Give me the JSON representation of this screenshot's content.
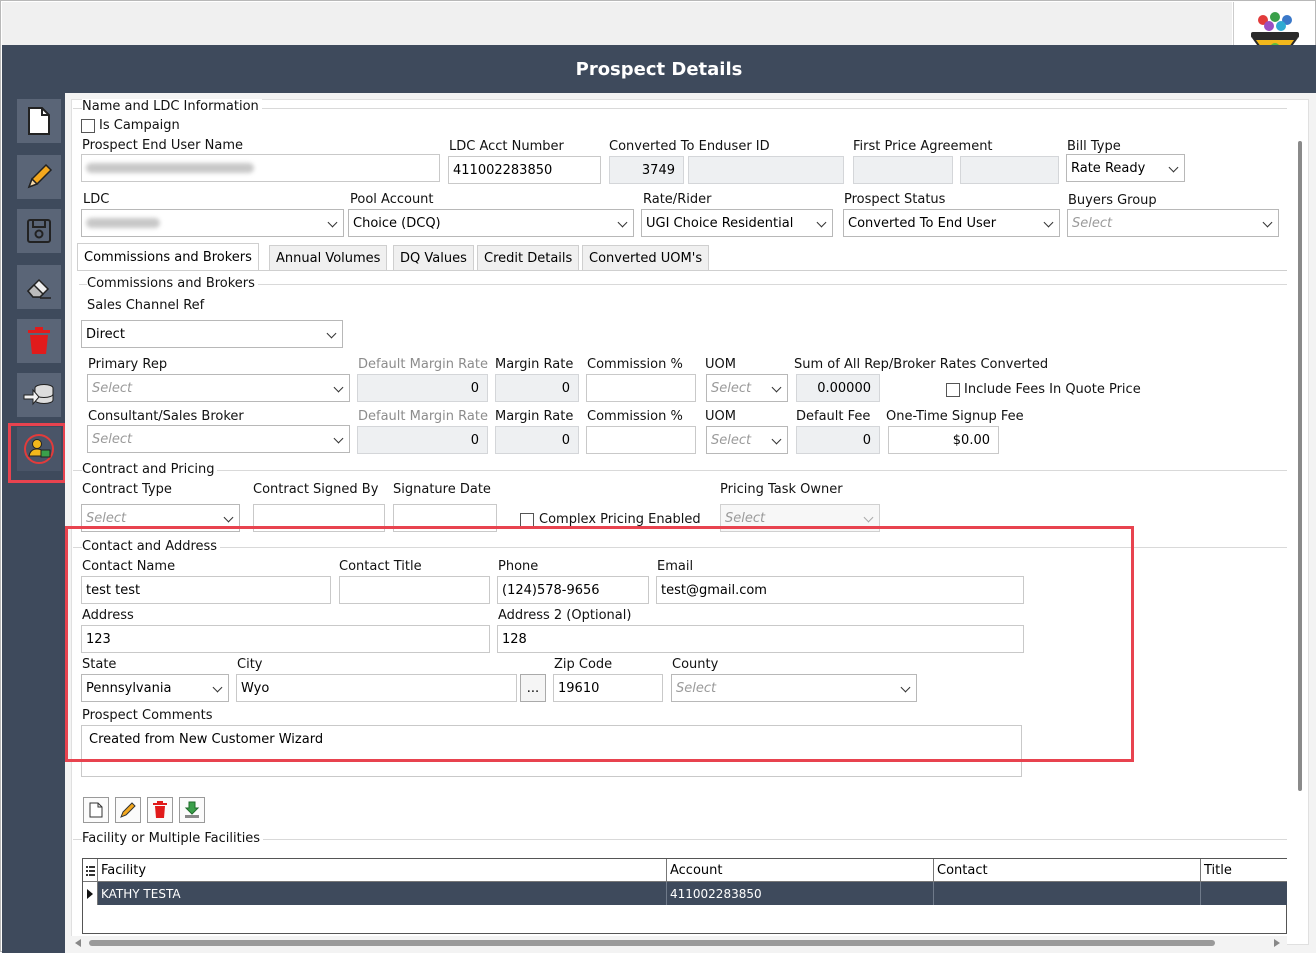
{
  "window": {
    "title": "Prospect Details"
  },
  "sidebar": {
    "buttons": [
      {
        "name": "new-document",
        "icon": "document-icon"
      },
      {
        "name": "edit",
        "icon": "pencil-icon"
      },
      {
        "name": "save",
        "icon": "floppy-disk-icon"
      },
      {
        "name": "clear",
        "icon": "eraser-icon"
      },
      {
        "name": "delete",
        "icon": "trash-icon"
      },
      {
        "name": "database",
        "icon": "database-arrow-icon"
      },
      {
        "name": "convert-user",
        "icon": "user-convert-icon"
      }
    ]
  },
  "name_ldc": {
    "group_label": "Name and LDC Information",
    "is_campaign_label": "Is Campaign",
    "prospect_end_user_name_label": "Prospect End User Name",
    "ldc_acct_number_label": "LDC Acct Number",
    "ldc_acct_number": "411002283850",
    "converted_to_enduser_id_label": "Converted To Enduser ID",
    "converted_to_enduser_id": "3749",
    "first_price_agreement_label": "First Price Agreement",
    "bill_type_label": "Bill Type",
    "bill_type": "Rate Ready",
    "ldc_label": "LDC",
    "pool_account_label": "Pool Account",
    "pool_account": "Choice (DCQ)",
    "rate_rider_label": "Rate/Rider",
    "rate_rider": "UGI Choice Residential",
    "prospect_status_label": "Prospect Status",
    "prospect_status": "Converted To End User",
    "buyers_group_label": "Buyers Group",
    "buyers_group_placeholder": "Select"
  },
  "tabs": [
    "Commissions and Brokers",
    "Annual Volumes",
    "DQ Values",
    "Credit Details",
    "Converted UOM's"
  ],
  "commissions": {
    "group_label": "Commissions and Brokers",
    "sales_channel_ref_label": "Sales Channel Ref",
    "sales_channel_ref": "Direct",
    "primary_rep_label": "Primary Rep",
    "select_placeholder": "Select",
    "default_margin_rate_label": "Default Margin Rate",
    "margin_rate_label": "Margin Rate",
    "commission_pct_label": "Commission %",
    "uom_label": "UOM",
    "sum_rates_label": "Sum of All Rep/Broker Rates Converted",
    "default_margin_rate_1": "0",
    "margin_rate_1": "0",
    "sum_rates": "0.00000",
    "include_fees_label": "Include Fees In Quote Price",
    "consultant_label": "Consultant/Sales Broker",
    "default_margin_rate_2": "0",
    "margin_rate_2": "0",
    "default_fee_label": "Default Fee",
    "default_fee": "0",
    "signup_fee_label": "One-Time Signup Fee",
    "signup_fee": "$0.00"
  },
  "contract": {
    "group_label": "Contract and Pricing",
    "contract_type_label": "Contract Type",
    "contract_signed_by_label": "Contract Signed By",
    "signature_date_label": "Signature Date",
    "complex_pricing_label": "Complex Pricing Enabled",
    "pricing_task_owner_label": "Pricing Task Owner",
    "select_placeholder": "Select"
  },
  "contact": {
    "group_label": "Contact and Address",
    "contact_name_label": "Contact Name",
    "contact_name": "test test",
    "contact_title_label": "Contact Title",
    "phone_label": "Phone",
    "phone": "(124)578-9656",
    "email_label": "Email",
    "email": "test@gmail.com",
    "address_label": "Address",
    "address": "123",
    "address2_label": "Address 2 (Optional)",
    "address2": "128",
    "state_label": "State",
    "state": "Pennsylvania",
    "city_label": "City",
    "city": "Wyo",
    "city_lookup_label": "...",
    "zip_label": "Zip Code",
    "zip": "19610",
    "county_label": "County",
    "county_placeholder": "Select",
    "comments_label": "Prospect Comments",
    "comments": "Created from New Customer Wizard"
  },
  "facilities": {
    "group_label": "Facility or Multiple Facilities",
    "columns": [
      "Facility",
      "Account",
      "Contact",
      "Title"
    ],
    "rows": [
      {
        "facility": "KATHY TESTA",
        "account": "411002283850",
        "contact": "",
        "title": ""
      }
    ]
  }
}
